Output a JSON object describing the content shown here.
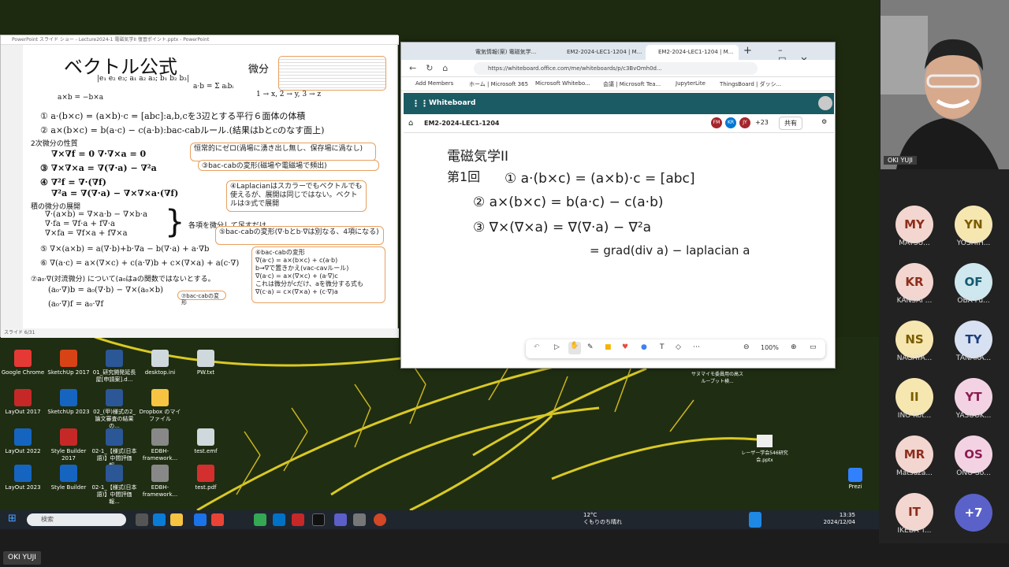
{
  "desktop": {
    "icons": [
      {
        "label": "Google Chrome",
        "color": "#e53935"
      },
      {
        "label": "SketchUp 2017",
        "color": "#d84315"
      },
      {
        "label": "01_研究開発延長屋[申請案].d...",
        "color": "#2b5797"
      },
      {
        "label": "desktop.ini",
        "color": "#cfd8dc"
      },
      {
        "label": "PW.txt",
        "color": "#cfd8dc"
      },
      {
        "label": "LayOut 2017",
        "color": "#c62828"
      },
      {
        "label": "SketchUp 2023",
        "color": "#1565c0"
      },
      {
        "label": "02_(甲)様式の2_論文審査の結果の...",
        "color": "#2b5797"
      },
      {
        "label": "Dropbox のマイファイル",
        "color": "#f6c343"
      },
      {
        "label": "LayOut 2022",
        "color": "#1565c0"
      },
      {
        "label": "Style Builder 2017",
        "color": "#c62828"
      },
      {
        "label": "02-1_【様式(日本語)】中間評価報...",
        "color": "#2b5797"
      },
      {
        "label": "EDBH-framework...",
        "color": "#888"
      },
      {
        "label": "test.emf",
        "color": "#cfd8dc"
      },
      {
        "label": "LayOut 2023",
        "color": "#1565c0"
      },
      {
        "label": "Style Builder",
        "color": "#1565c0"
      },
      {
        "label": "02-1_【様式(日本語)】中間評価報...",
        "color": "#2b5797"
      },
      {
        "label": "EDBH-framework...",
        "color": "#888"
      },
      {
        "label": "test.pdf",
        "color": "#d32f2f"
      }
    ],
    "right_icons": [
      {
        "label": "サヌマイモ委員用の高スループット検..."
      },
      {
        "label": "レーザー学会546研究会.pptx"
      },
      {
        "label": "Prezi"
      }
    ]
  },
  "taskbar": {
    "search_placeholder": "検索",
    "weather_temp": "12°C",
    "weather_desc": "くもりのち晴れ",
    "time": "13:35",
    "date": "2024/12/04"
  },
  "ppt": {
    "window_title": "PowerPoint スライド ショー - Lecture2024-1 電磁気学II 復習ポイント.pptx - PowerPoint",
    "status": "スライド 6/31",
    "slide": {
      "title": "ベクトル公式",
      "bibun": "微分",
      "outer": "a×b = −b×a",
      "inner": "a·b = Σ aᵢbᵢ",
      "cycle": "1 → x, 2 → y, 3 → z",
      "det": "|e₁ e₂ e₃; a₁ a₂ a₃; b₁ b₂ b₃|",
      "l1": "① a·(b×c) = (a×b)·c = [abc]:a,b,cを3辺とする平行６面体の体積",
      "l2": "② a×(b×c) = b(a·c) − c(a·b):bac-cabルール.(結果はbとcのなす面上)",
      "l3": "2次微分の性質",
      "l4": "∇×∇f = 0  ∇·∇×a = 0",
      "l5": "③ ∇×∇×a = ∇(∇·a) − ∇²a",
      "l6": "④ ∇²f = ∇·(∇f)",
      "l7": "∇²a = ∇(∇·a) − ∇×∇×a·(∇f)",
      "l8": "積の微分の展開",
      "l9": "∇·(a×b) = ∇×a·b − ∇×b·a",
      "l10": "∇·fa = ∇f·a + f∇·a",
      "l11": "∇×fa = ∇f×a + f∇×a",
      "l12": "⑤ ∇×(a×b) = a(∇·b)+b·∇a − b(∇·a) + a·∇b",
      "l13": "⑥ ∇(a·c) = a×(∇×c) + c(a·∇)b + c×(∇×a) + a(c·∇)",
      "l14": "⑦a₀·∇(対流微分) について(a₀はaの関数ではないとする。",
      "l15": "(a₀·∇)b = a₀(∇·b) − ∇×(a₀×b)",
      "l16": "(a₀·∇)f = a₀·∇f",
      "n1": "恒常的にゼロ(渦場に湧き出し無し、保存場に渦なし)",
      "n2": "③bac-cabの変形(磁場や電磁場で頻出)",
      "n3": "④Laplacianはスカラーでもベクトルでも使えるが、展開は同じではない。ベクトルは③式で展開",
      "n4": "各項を微分して足すだけ",
      "n5": "⑤bac-cabの変形(∇·bとb·∇は別なる、4項になる)",
      "n6": "⑥bac-cabの変形\n∇(a·c) = a×(b×c) + c(a·b)\nb→∇で置きかえ(vac-cavルール)\n∇(a·c) = a×(∇×c) + (a·∇)c\nこれは微分がcだけ、aを微分する式も\n∇(c·a) = c×(∇×a) + (c·∇)a",
      "n7": "⑦bac-cabの変形"
    }
  },
  "edge": {
    "tabs": [
      "電気情報(案) 電磁気学...",
      "EM2-2024-LEC1-1204 | M...",
      "EM2-2024-LEC1-1204 | M..."
    ],
    "url": "https://whiteboard.office.com/me/whiteboards/p/c3BvOmh0d...",
    "favorites": [
      "Add Members",
      "ホーム | Microsoft 365",
      "Microsoft Whitebo...",
      "会議 | Microsoft Tea...",
      "JupyterLite",
      "ThingsBoard | ダッシ..."
    ],
    "app_name": "Whiteboard",
    "board_name": "EM2-2024-LEC1-1204",
    "avatars": [
      {
        "initials": "FM",
        "color": "#a4262c"
      },
      {
        "initials": "KR",
        "color": "#0078d4"
      },
      {
        "initials": "JY",
        "color": "#a4262c"
      }
    ],
    "more": "+23",
    "share": "共有",
    "zoom": "100%"
  },
  "whiteboard": {
    "heading": "電磁気学II",
    "lecture": "第1回",
    "eq1": "① a·(b×c) = (a×b)·c = [abc]",
    "eq2": "② a×(b×c) = b(a·c) − c(a·b)",
    "eq3": "③ ∇×(∇×a) = ∇(∇·a) − ∇²a",
    "eq4": "= grad(div a) − laplacian a"
  },
  "participants": {
    "presenter": "OKI YUJI",
    "list": [
      {
        "initials": "MY",
        "name": "MATSU...",
        "bg": "#f3d6cf",
        "fg": "#8c2f1c"
      },
      {
        "initials": "YN",
        "name": "YOSHIH...",
        "bg": "#f6e6b0",
        "fg": "#7a5c00"
      },
      {
        "initials": "KR",
        "name": "KANSAI ...",
        "bg": "#f3d6cf",
        "fg": "#8c2f1c"
      },
      {
        "initials": "OF",
        "name": "OBA Fu...",
        "bg": "#cfe7ee",
        "fg": "#155a6e"
      },
      {
        "initials": "NS",
        "name": "NAGATA...",
        "bg": "#f6e6b0",
        "fg": "#7a5c00"
      },
      {
        "initials": "TY",
        "name": "TANAKA...",
        "bg": "#d7e1f2",
        "fg": "#1e3f7a"
      },
      {
        "initials": "II",
        "name": "INO Kot...",
        "bg": "#f6e6b0",
        "fg": "#7a5c00"
      },
      {
        "initials": "YT",
        "name": "YASUOK...",
        "bg": "#f3d3e3",
        "fg": "#8c1c52"
      },
      {
        "initials": "MR",
        "name": "Matsuza...",
        "bg": "#f3d6cf",
        "fg": "#8c2f1c"
      },
      {
        "initials": "OS",
        "name": "ONO So...",
        "bg": "#f3d3e3",
        "fg": "#8c1c52"
      },
      {
        "initials": "IT",
        "name": "IKEDA T...",
        "bg": "#f3d6cf",
        "fg": "#8c2f1c"
      }
    ],
    "overflow": "+7"
  }
}
